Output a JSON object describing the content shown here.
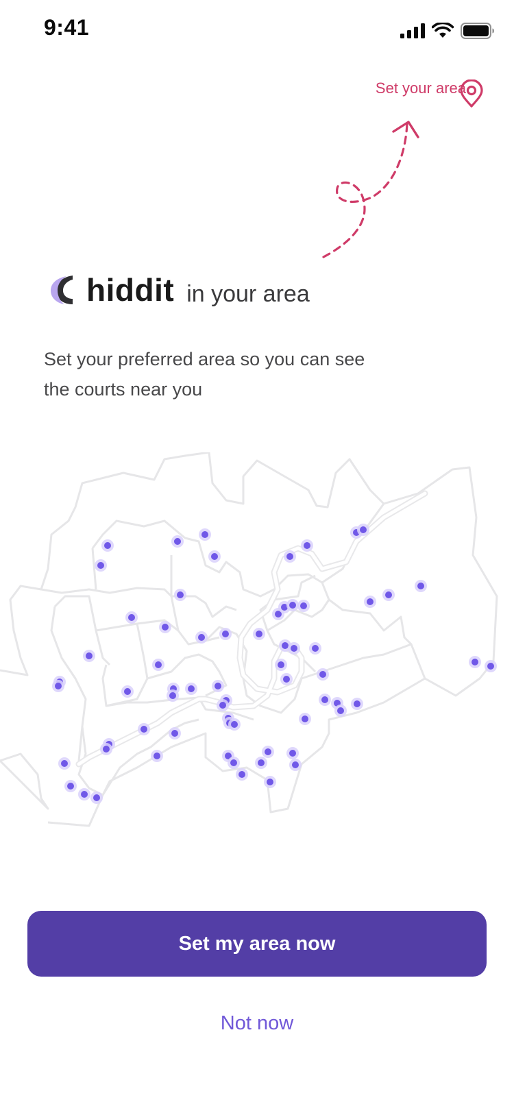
{
  "status_bar": {
    "time": "9:41",
    "icons": [
      "cellular-signal-icon",
      "wifi-icon",
      "battery-icon"
    ]
  },
  "area_link": {
    "label": "Set your area",
    "icon": "map-pin-icon",
    "color": "#cf3b68"
  },
  "brand": {
    "name": "hiddit",
    "suffix": "in your area",
    "logo_icon": "hiddit-logo-icon"
  },
  "subtitle": "Set your preferred area so you can see the courts near you",
  "map": {
    "icon": "district-map",
    "marker_icon": "court-marker-icon",
    "marker_color": "#7058e8"
  },
  "primary_button": {
    "label": "Set my area now",
    "color": "#533ea6"
  },
  "secondary_button": {
    "label": "Not now",
    "color": "#7058d8"
  }
}
